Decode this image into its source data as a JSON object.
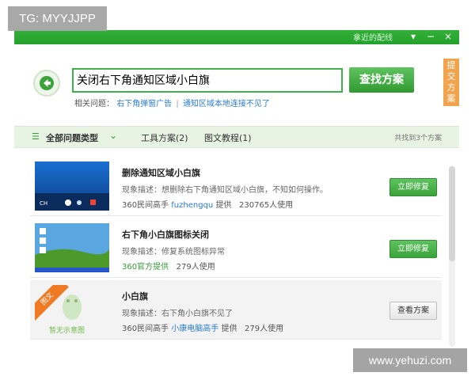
{
  "overlay": {
    "tg_label": "TG: MYYJJPP",
    "watermark": "www.yehuzi.com"
  },
  "titlebar": {
    "link": "拿近的配线",
    "buttons": {
      "menu": "▾",
      "minimize": "−",
      "close": "×"
    }
  },
  "search": {
    "query": "关闭右下角通知区域小白旗",
    "button_label": "查找方案"
  },
  "feedback_tab": "提交方案",
  "related": {
    "label": "相关问题：",
    "links": [
      "右下角弹窗广告",
      "通知区域本地连接不见了"
    ],
    "separator": "|"
  },
  "filterbar": {
    "all_label": "全部问题类型",
    "tabs": [
      "工具方案(2)",
      "图文教程(1)"
    ],
    "count_text": "共找到3个方案"
  },
  "results": [
    {
      "title": "删除通知区域小白旗",
      "desc": "现象描述：想删除右下角通知区域小白旗，不知如何操作。",
      "source": "360民间高手",
      "author": "fuzhengqu",
      "provide": "提供",
      "users": "230765人使用",
      "button": "立即修复",
      "thumb_text": "CH"
    },
    {
      "title": "右下角小白旗图标关闭",
      "desc": "现象描述：修复系统图标异常",
      "source": "360官方提供",
      "users": "279人使用",
      "button": "立即修复"
    },
    {
      "title": "小白旗",
      "desc": "现象描述：右下角小白旗不见了",
      "source": "360民间高手",
      "author": "小康电脑高手",
      "provide": "提供",
      "users": "279人使用",
      "button": "查看方案",
      "tag": "图文",
      "no_image_text": "暂无示意图"
    }
  ],
  "colors": {
    "accent_green": "#3aa33a",
    "link_blue": "#2a7bd2",
    "feedback_orange": "#f2a34c",
    "tag_orange": "#f07a24"
  }
}
